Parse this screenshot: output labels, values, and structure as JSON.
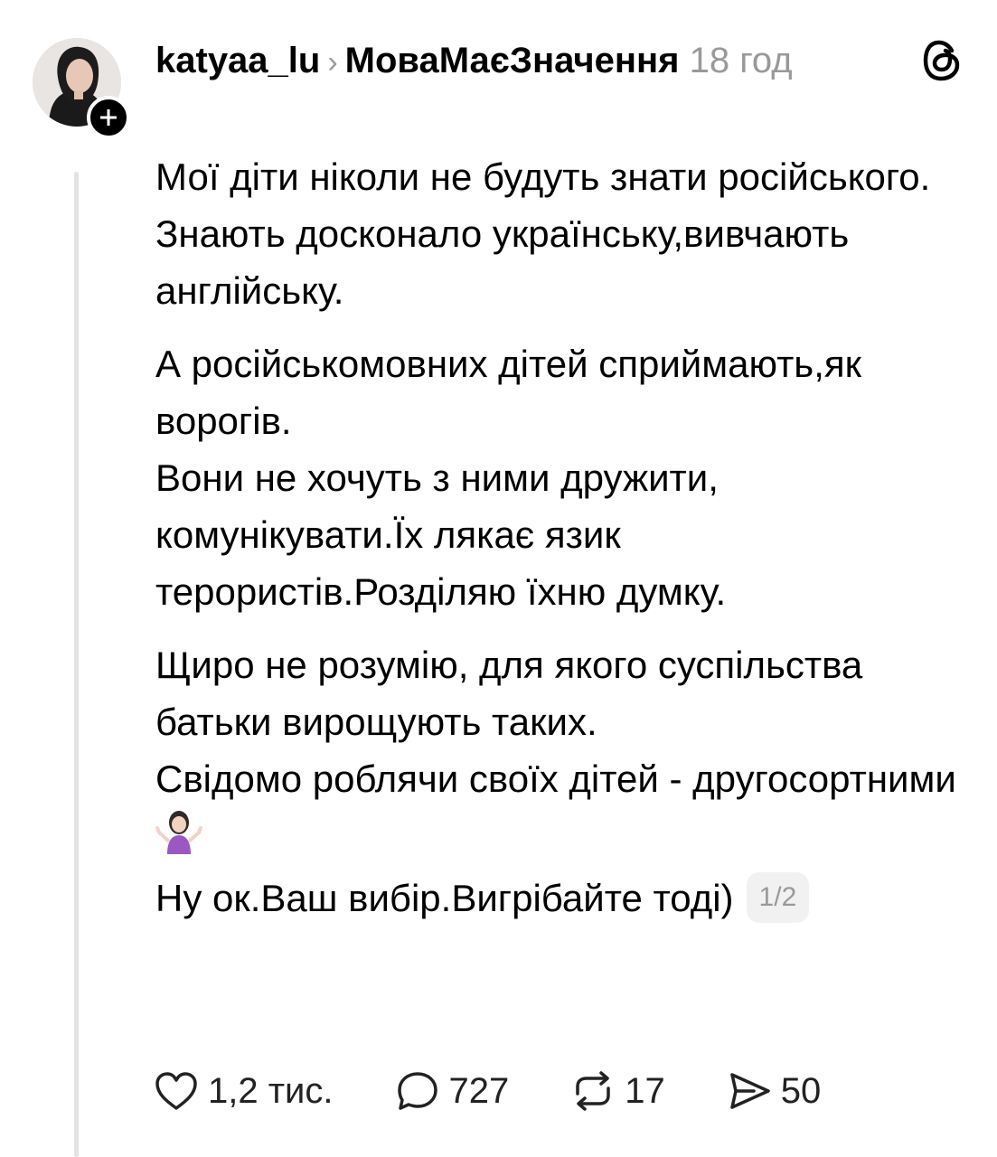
{
  "post": {
    "username": "katyaa_lu",
    "separator": "›",
    "community": "МоваМаєЗначення",
    "time": "18 год",
    "paragraphs": [
      "Мої діти ніколи не будуть знати російського.",
      "Знають досконало українську,вивчають англійську.",
      "А російськомовних дітей сприймають,як ворогів.",
      "Вони не хочуть з ними дружити, комунікувати.Їх лякає язик терористів.Розділяю їхню думку.",
      "Щиро не розумію, для якого суспільства батьки вирощують таких.",
      "Свідомо роблячи своїх дітей - другосортними",
      "Ну ок.Ваш вибір.Вигрібайте тоді)"
    ],
    "page_indicator": "1/2",
    "emoji_icon": "woman-shrugging-emoji",
    "logo_icon": "threads-logo-icon",
    "follow_icon": "plus-icon"
  },
  "actions": {
    "likes": "1,2 тис.",
    "comments": "727",
    "reposts": "17",
    "shares": "50"
  },
  "colors": {
    "text": "#000000",
    "muted": "#999999",
    "thread_line": "#e3e3e3",
    "badge_bg": "#f1f1f1"
  }
}
